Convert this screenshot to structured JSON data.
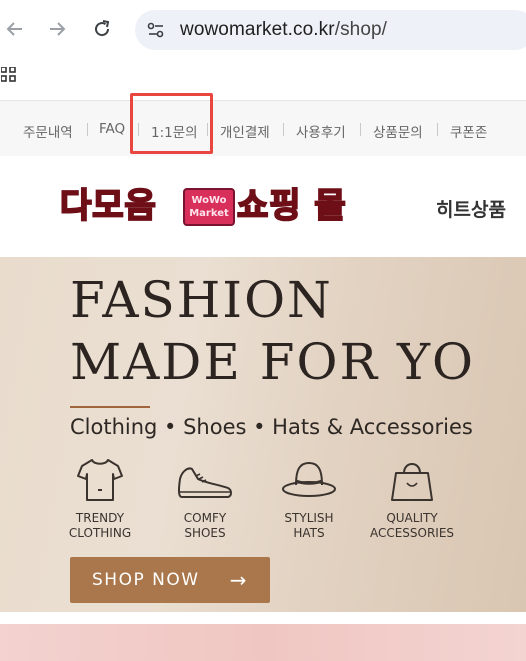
{
  "browser": {
    "url_host": "wowomarket.co.kr",
    "url_path": "/shop/"
  },
  "top_menu": {
    "items": [
      {
        "label": "주문내역"
      },
      {
        "label": "FAQ"
      },
      {
        "label": "1:1문의"
      },
      {
        "label": "개인결제"
      },
      {
        "label": "사용후기"
      },
      {
        "label": "상품문의"
      },
      {
        "label": "쿠폰존"
      }
    ],
    "highlight_color": "#e8463f"
  },
  "header": {
    "logo_left": "다모음",
    "logo_mid_top": "WoWo",
    "logo_mid_bottom": "Market",
    "logo_right": "쇼핑 몰",
    "nav_label": "히트상품"
  },
  "banner": {
    "title_line1": "FASHION",
    "title_line2": "MADE FOR YO",
    "subtitle": "Clothing • Shoes • Hats & Accessories",
    "features": [
      {
        "icon": "tshirt-icon",
        "line1": "TRENDY",
        "line2": "CLOTHING"
      },
      {
        "icon": "shoe-icon",
        "line1": "COMFY",
        "line2": "SHOES"
      },
      {
        "icon": "hat-icon",
        "line1": "STYLISH",
        "line2": "HATS"
      },
      {
        "icon": "bag-icon",
        "line1": "QUALITY",
        "line2": "ACCESSORIES"
      }
    ],
    "cta_label": "SHOP NOW",
    "cta_arrow": "→",
    "accent_color": "#a9774b"
  }
}
